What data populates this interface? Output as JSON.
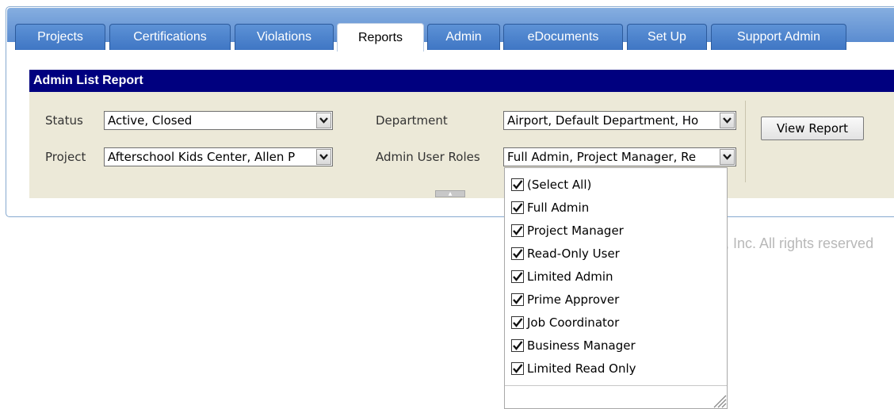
{
  "tabs": [
    {
      "label": "Projects"
    },
    {
      "label": "Certifications"
    },
    {
      "label": "Violations"
    },
    {
      "label": "Reports",
      "active": true
    },
    {
      "label": "Admin"
    },
    {
      "label": "eDocuments"
    },
    {
      "label": "Set Up"
    },
    {
      "label": "Support Admin"
    }
  ],
  "report": {
    "title": "Admin List Report",
    "view_report_label": "View Report"
  },
  "filters": {
    "status": {
      "label": "Status",
      "value": "Active, Closed"
    },
    "project": {
      "label": "Project",
      "value": "Afterschool Kids Center, Allen P"
    },
    "department": {
      "label": "Department",
      "value": "Airport, Default Department, Ho"
    },
    "admin_user_roles": {
      "label": "Admin User Roles",
      "value": "Full Admin, Project Manager, Re"
    }
  },
  "roles_dropdown": {
    "options": [
      {
        "label": "(Select All)",
        "checked": true
      },
      {
        "label": "Full Admin",
        "checked": true
      },
      {
        "label": "Project Manager",
        "checked": true
      },
      {
        "label": "Read-Only User",
        "checked": true
      },
      {
        "label": "Limited Admin",
        "checked": true
      },
      {
        "label": "Prime Approver",
        "checked": true
      },
      {
        "label": "Job Coordinator",
        "checked": true
      },
      {
        "label": "Business Manager",
        "checked": true
      },
      {
        "label": "Limited Read Only",
        "checked": true
      }
    ]
  },
  "footer": {
    "text": ", Inc. All rights reserved"
  },
  "colors": {
    "tab_bar": "#5b8cd0",
    "report_header": "#00007f",
    "filter_panel": "#ece9d8"
  }
}
